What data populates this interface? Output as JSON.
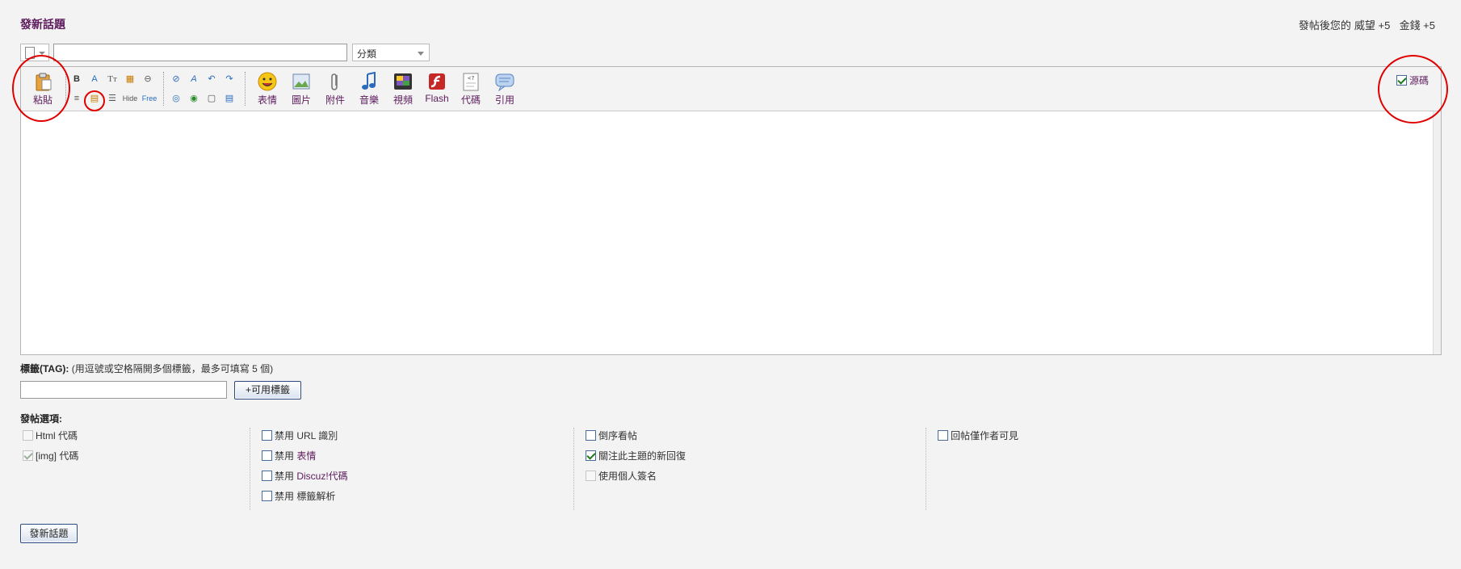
{
  "header": {
    "title": "發新話題",
    "reward_prefix": "發帖後您的",
    "reward_items": [
      "威望 +5",
      "金錢 +5"
    ]
  },
  "subject": {
    "value": "",
    "category": "分類"
  },
  "toolbar": {
    "paste": "粘貼",
    "small_buttons_row1": [
      "B",
      "A",
      "Tт",
      "▦",
      "⊖"
    ],
    "small_buttons_row2": [
      "≡",
      "▤",
      "☰",
      "Hide",
      "Free"
    ],
    "small_buttons_row3": [
      "⊘",
      "A",
      "↶",
      "↷"
    ],
    "small_buttons_row4": [
      "◎",
      "◉",
      "▢",
      "▤"
    ],
    "big_buttons": [
      "表情",
      "圖片",
      "附件",
      "音樂",
      "視頻",
      "Flash",
      "代碼",
      "引用"
    ],
    "source_label": "源碼",
    "source_checked": true
  },
  "tags": {
    "label_bold": "標籤(TAG):",
    "label_hint": " (用逗號或空格隔開多個標籤，最多可填寫 5 個)",
    "value": "",
    "available_button": "+可用標籤"
  },
  "options": {
    "title": "發帖選項:",
    "col1": [
      {
        "label": "Html 代碼",
        "checked": false,
        "disabled": true
      },
      {
        "label": "[img] 代碼",
        "checked": true,
        "disabled": true
      }
    ],
    "col2": [
      {
        "prefix": "禁用 ",
        "label": "URL 識別",
        "checked": false
      },
      {
        "prefix": "禁用 ",
        "label": "表情",
        "checked": false
      },
      {
        "prefix": "禁用 ",
        "label": "Discuz!代碼",
        "checked": false
      },
      {
        "prefix": "禁用 ",
        "label": "標籤解析",
        "checked": false
      }
    ],
    "col3": [
      {
        "label": "倒序看帖",
        "checked": false,
        "disabled": false
      },
      {
        "label": "關注此主題的新回復",
        "checked": true,
        "disabled": false
      },
      {
        "label": "使用個人簽名",
        "checked": false,
        "disabled": true
      }
    ],
    "col4": [
      {
        "label": "回帖僅作者可見",
        "checked": false,
        "disabled": false
      }
    ]
  },
  "submit": {
    "label": "發新話題"
  },
  "colors": {
    "accent": "#5c1a5c",
    "highlight_circle": "#e00000"
  }
}
